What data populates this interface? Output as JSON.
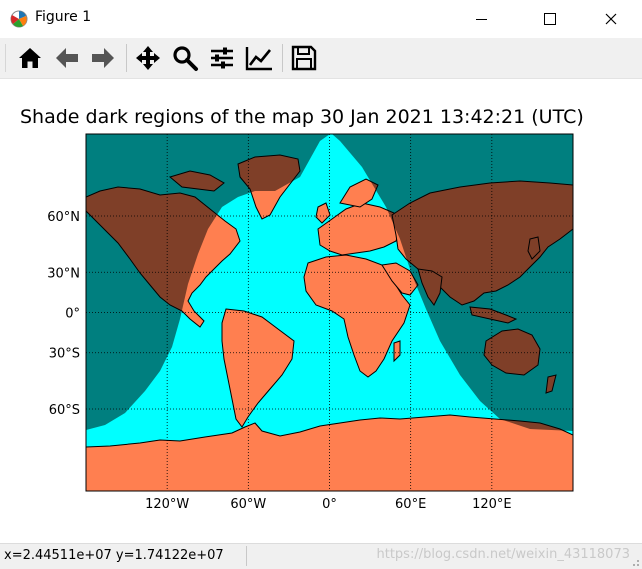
{
  "window": {
    "title": "Figure 1",
    "controls": {
      "minimize": "—",
      "maximize": "☐",
      "close": "✕"
    }
  },
  "toolbar": {
    "buttons": [
      {
        "name": "home-icon"
      },
      {
        "name": "back-icon"
      },
      {
        "name": "forward-icon"
      },
      {
        "name": "pan-icon"
      },
      {
        "name": "zoom-icon"
      },
      {
        "name": "configure-subplots-icon"
      },
      {
        "name": "edit-axis-icon"
      },
      {
        "name": "save-icon"
      }
    ]
  },
  "figure": {
    "title": "Shade dark regions of the map 30 Jan 2021 13:42:21 (UTC)"
  },
  "chart_data": {
    "type": "map",
    "projection": "mercator",
    "title": "Shade dark regions of the map 30 Jan 2021 13:42:21 (UTC)",
    "x_ticks": [
      "120°W",
      "60°W",
      "0°",
      "60°E",
      "120°E"
    ],
    "y_ticks": [
      "60°N",
      "30°N",
      "0°",
      "30°S",
      "60°S"
    ],
    "x_tick_values": [
      -120,
      -60,
      0,
      60,
      120
    ],
    "y_tick_values": [
      60,
      30,
      0,
      -30,
      -60
    ],
    "xlim": [
      -180,
      180
    ],
    "ylim": [
      -80,
      80
    ],
    "grid": true,
    "grid_style": "dotted",
    "colors": {
      "ocean": "#00ffff",
      "land": "#ff7f50",
      "night_shade": "#000000",
      "coastline": "#000000"
    },
    "datetime_utc": "30 Jan 2021 13:42:21"
  },
  "status": {
    "coords": "x=2.44511e+07  y=1.74122e+07",
    "watermark": "https://blog.csdn.net/weixin_43118073"
  }
}
